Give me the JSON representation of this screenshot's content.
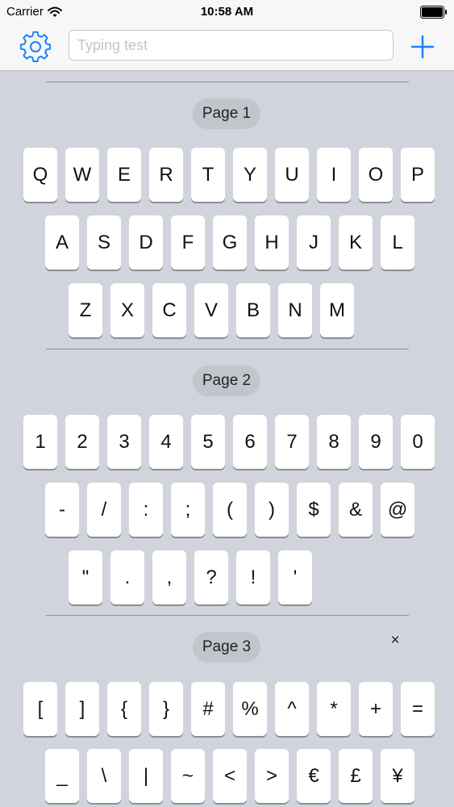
{
  "status_bar": {
    "carrier": "Carrier",
    "time": "10:58 AM"
  },
  "nav_bar": {
    "settings_icon": "gear-icon",
    "search_placeholder": "Typing test",
    "search_value": "",
    "add_icon": "plus-icon"
  },
  "colors": {
    "accent": "#1a82fb",
    "background": "#d1d4dc",
    "key": "#ffffff",
    "pill": "#c3c5cc"
  },
  "pages": [
    {
      "title": "Page 1",
      "rows": [
        [
          "Q",
          "W",
          "E",
          "R",
          "T",
          "Y",
          "U",
          "I",
          "O",
          "P"
        ],
        [
          "A",
          "S",
          "D",
          "F",
          "G",
          "H",
          "J",
          "K",
          "L"
        ],
        [
          "Z",
          "X",
          "C",
          "V",
          "B",
          "N",
          "M"
        ]
      ]
    },
    {
      "title": "Page 2",
      "rows": [
        [
          "1",
          "2",
          "3",
          "4",
          "5",
          "6",
          "7",
          "8",
          "9",
          "0"
        ],
        [
          "-",
          "/",
          ":",
          ";",
          "(",
          ")",
          "$",
          "&",
          "@"
        ],
        [
          "\"",
          ".",
          ",",
          "?",
          "!",
          "'"
        ]
      ]
    },
    {
      "title": "Page 3",
      "closable": true,
      "close_label": "×",
      "rows": [
        [
          "[",
          "]",
          "{",
          "}",
          "#",
          "%",
          "^",
          "*",
          "+",
          "="
        ],
        [
          "_",
          "\\",
          "|",
          "~",
          "<",
          ">",
          "€",
          "£",
          "¥"
        ]
      ]
    }
  ]
}
